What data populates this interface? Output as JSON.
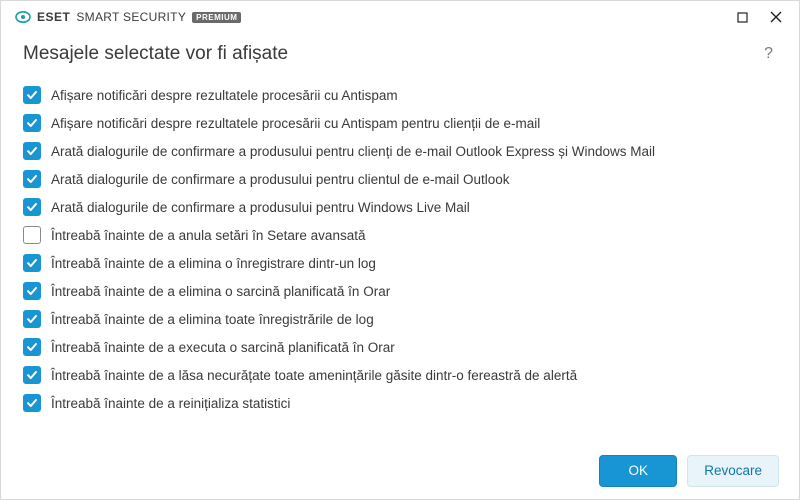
{
  "brand": {
    "company": "ESET",
    "product": "SMART SECURITY",
    "edition": "PREMIUM"
  },
  "header": {
    "title": "Mesajele selectate vor fi afișate"
  },
  "items": [
    {
      "checked": true,
      "label": "Afișare notificări despre rezultatele procesării cu Antispam"
    },
    {
      "checked": true,
      "label": "Afișare notificări despre rezultatele procesării cu Antispam pentru clienții de e-mail"
    },
    {
      "checked": true,
      "label": "Arată dialogurile de confirmare a produsului pentru clienți de e-mail Outlook Express și Windows Mail"
    },
    {
      "checked": true,
      "label": "Arată dialogurile de confirmare a produsului pentru clientul de e-mail Outlook"
    },
    {
      "checked": true,
      "label": "Arată dialogurile de confirmare a produsului pentru Windows Live Mail"
    },
    {
      "checked": false,
      "label": "Întreabă înainte de a anula setări în Setare avansată"
    },
    {
      "checked": true,
      "label": "Întreabă înainte de a elimina o înregistrare dintr-un log"
    },
    {
      "checked": true,
      "label": "Întreabă înainte de a elimina o sarcină planificată în Orar"
    },
    {
      "checked": true,
      "label": "Întreabă înainte de a elimina toate înregistrările de log"
    },
    {
      "checked": true,
      "label": "Întreabă înainte de a executa o sarcină planificată în Orar"
    },
    {
      "checked": true,
      "label": "Întreabă înainte de a lăsa necurățate toate amenințările găsite dintr-o fereastră de alertă"
    },
    {
      "checked": true,
      "label": "Întreabă înainte de a reinițializa statistici"
    }
  ],
  "footer": {
    "ok": "OK",
    "cancel": "Revocare"
  },
  "help_glyph": "?"
}
